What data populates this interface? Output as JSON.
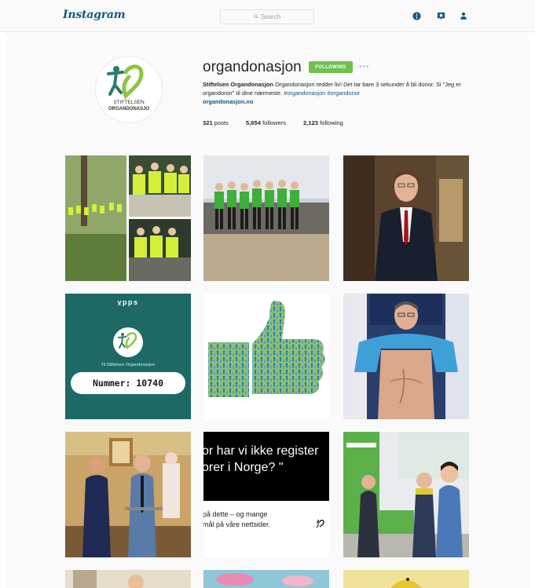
{
  "header": {
    "logo": "Instagram",
    "search_placeholder": "Search",
    "icons": [
      "compass-icon",
      "heart-bubble-icon",
      "person-icon"
    ]
  },
  "profile": {
    "username": "organdonasjon",
    "follow_label": "FOLLOWING",
    "more_label": "•••",
    "avatar_text_top": "STIFTELSEN",
    "avatar_text_bottom": "ORGANDONASJO",
    "bio_name": "Stiftelsen Organdonasjon",
    "bio_text": " Organdonasjon redder liv! Det tar bare 3 sekunder å bli donor. Si \"Jeg er organdonor\" til dine nærmeste. ",
    "bio_tags": "#organdonasjon #organdonor",
    "bio_link": "organdonasjon.no",
    "stats": {
      "posts_count": "321",
      "posts_label": " posts",
      "followers_count": "5,654",
      "followers_label": " followers",
      "following_count": "2,123",
      "following_label": " following"
    }
  },
  "posts": {
    "vipps": {
      "brand": "v̲pps",
      "org": "Til Stiftelsen Organdonasjon",
      "number": "Nummer: 10740"
    },
    "quote": {
      "line1": "or har vi ikke register",
      "line2": "orer i Norge? \"",
      "sub1": "på dette – og mange",
      "sub2": "mål på våre nettsider."
    }
  },
  "colors": {
    "brand_blue": "#125688",
    "follow_green": "#70c050",
    "teal": "#1d6a64",
    "logo_green": "#8cc63f",
    "logo_teal": "#2b7a6e"
  }
}
